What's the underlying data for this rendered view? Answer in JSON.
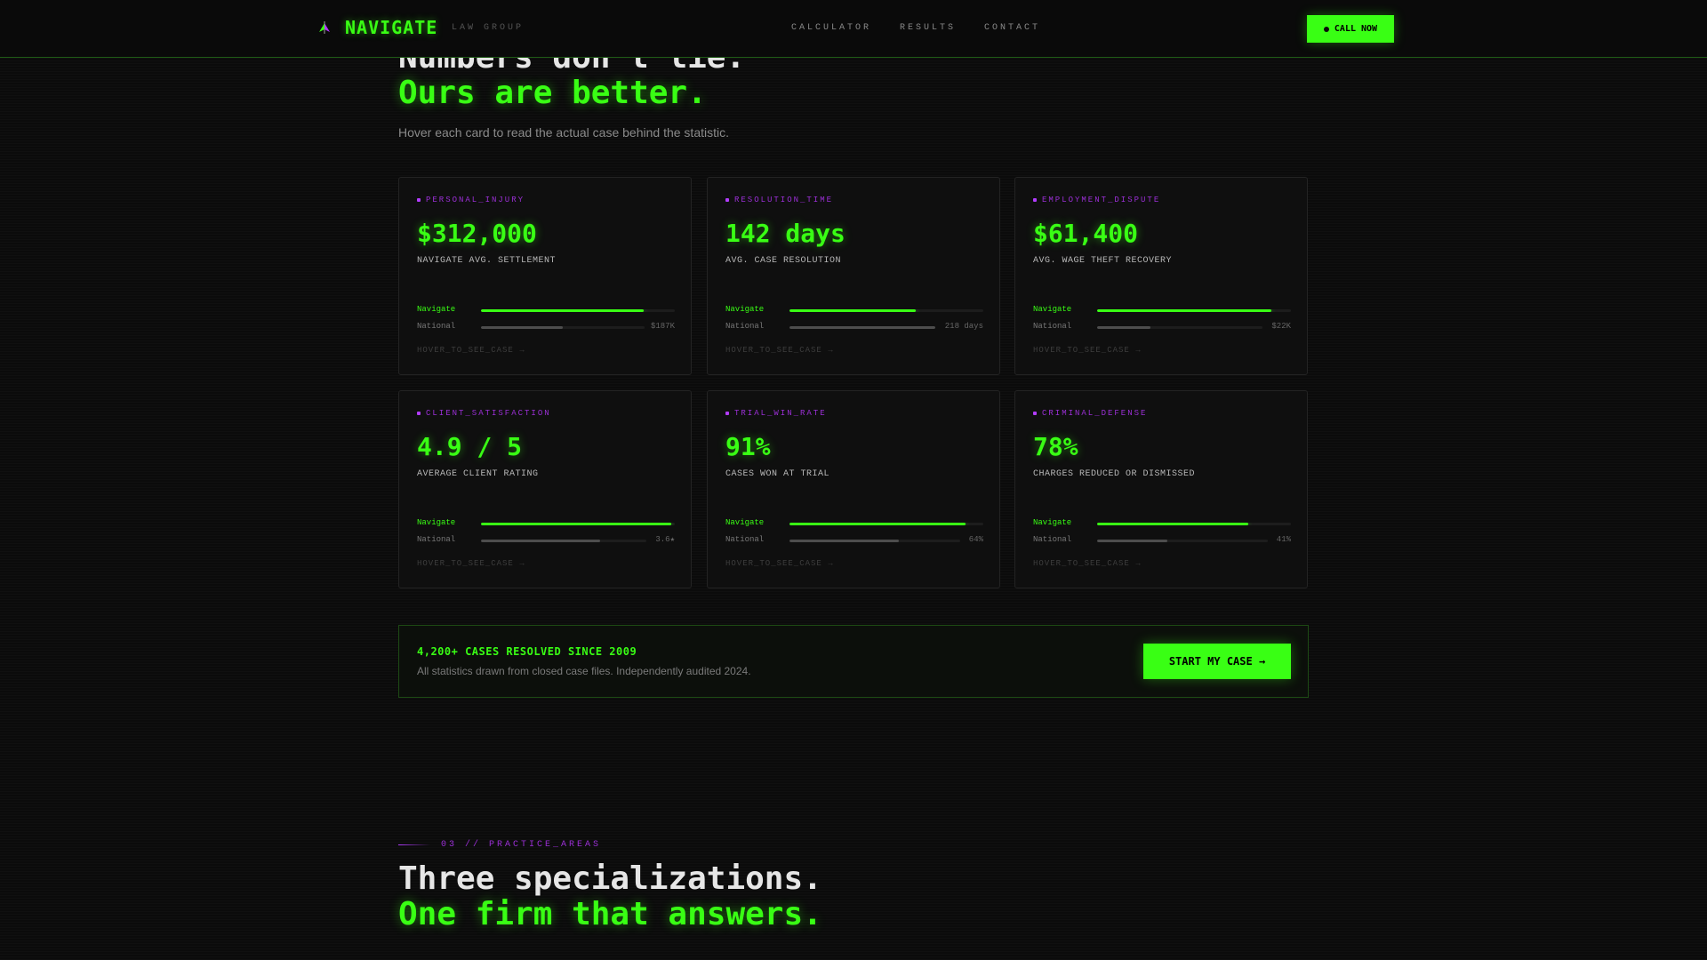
{
  "header": {
    "brand": "NAVIGATE",
    "brand_sub": "LAW GROUP",
    "nav": [
      "CALCULATOR",
      "RESULTS",
      "CONTACT"
    ],
    "cta": "CALL NOW"
  },
  "hero": {
    "line1": "Numbers don't lie.",
    "line2": "Ours are better.",
    "subtitle": "Hover each card to read the actual case behind the statistic."
  },
  "cards": [
    {
      "tag": "PERSONAL_INJURY",
      "value": "$312,000",
      "label": "NAVIGATE AVG. SETTLEMENT",
      "row1_label": "Navigate",
      "row2_label": "National",
      "row2_value": "$187K",
      "navigate_pct": 0.84,
      "national_pct": 0.5,
      "hover": "HOVER_TO_SEE_CASE →"
    },
    {
      "tag": "RESOLUTION_TIME",
      "value": "142 days",
      "label": "AVG. CASE RESOLUTION",
      "row1_label": "Navigate",
      "row2_label": "National",
      "row2_value": "218 days",
      "navigate_pct": 0.65,
      "national_pct": 1.0,
      "hover": "HOVER_TO_SEE_CASE →"
    },
    {
      "tag": "EMPLOYMENT_DISPUTE",
      "value": "$61,400",
      "label": "AVG. WAGE THEFT RECOVERY",
      "row1_label": "Navigate",
      "row2_label": "National",
      "row2_value": "$22K",
      "navigate_pct": 0.9,
      "national_pct": 0.32,
      "hover": "HOVER_TO_SEE_CASE →"
    },
    {
      "tag": "CLIENT_SATISFACTION",
      "value": "4.9 / 5",
      "label": "AVERAGE CLIENT RATING",
      "row1_label": "Navigate",
      "row2_label": "National",
      "row2_value": "3.6★",
      "navigate_pct": 0.98,
      "national_pct": 0.72,
      "hover": "HOVER_TO_SEE_CASE →"
    },
    {
      "tag": "TRIAL_WIN_RATE",
      "value": "91%",
      "label": "CASES WON AT TRIAL",
      "row1_label": "Navigate",
      "row2_label": "National",
      "row2_value": "64%",
      "navigate_pct": 0.91,
      "national_pct": 0.64,
      "hover": "HOVER_TO_SEE_CASE →"
    },
    {
      "tag": "CRIMINAL_DEFENSE",
      "value": "78%",
      "label": "CHARGES REDUCED OR DISMISSED",
      "row1_label": "Navigate",
      "row2_label": "National",
      "row2_value": "41%",
      "navigate_pct": 0.78,
      "national_pct": 0.41,
      "hover": "HOVER_TO_SEE_CASE →"
    }
  ],
  "banner": {
    "title": "4,200+ CASES RESOLVED SINCE 2009",
    "subtitle": "All statistics drawn from closed case files. Independently audited 2024.",
    "cta": "START MY CASE →"
  },
  "practice": {
    "tag": "03 // PRACTICE_AREAS",
    "line1": "Three specializations.",
    "line2": "One firm that answers."
  },
  "colors": {
    "accent": "#39ff14",
    "tag": "#9b2fd6",
    "bg": "#0b0b0b"
  }
}
